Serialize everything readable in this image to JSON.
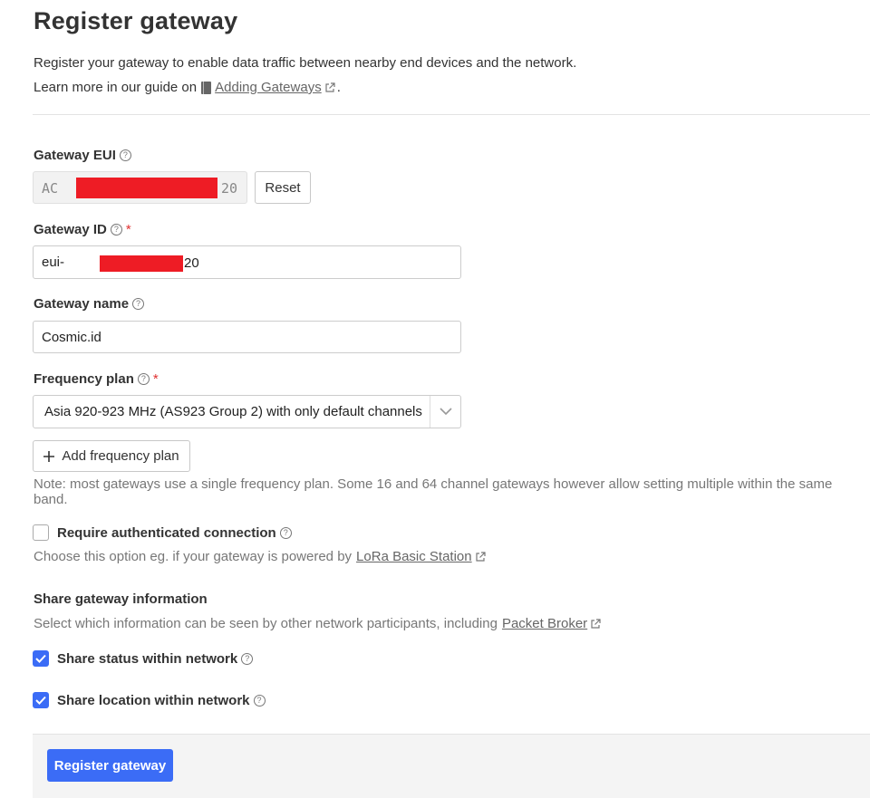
{
  "header": {
    "title": "Register gateway",
    "description": "Register your gateway to enable data traffic between nearby end devices and the network.",
    "guide_prefix": "Learn more in our guide on",
    "guide_link": "Adding Gateways",
    "guide_suffix": "."
  },
  "eui": {
    "label": "Gateway EUI",
    "prefix": "AC",
    "suffix": "20",
    "reset_label": "Reset"
  },
  "gateway_id": {
    "label": "Gateway ID",
    "required_mark": "*",
    "prefix": "eui-",
    "suffix": "20"
  },
  "gateway_name": {
    "label": "Gateway name",
    "value": "Cosmic.id"
  },
  "frequency": {
    "label": "Frequency plan",
    "required_mark": "*",
    "selected": "Asia 920-923 MHz (AS923 Group 2) with only default channels",
    "add_label": "Add frequency plan",
    "note": "Note: most gateways use a single frequency plan. Some 16 and 64 channel gateways however allow setting multiple within the same band."
  },
  "auth": {
    "label": "Require authenticated connection",
    "checked": false,
    "hint_prefix": "Choose this option eg. if your gateway is powered by",
    "hint_link": "LoRa Basic Station"
  },
  "share": {
    "heading": "Share gateway information",
    "hint_prefix": "Select which information can be seen by other network participants, including",
    "hint_link": "Packet Broker",
    "status_label": "Share status within network",
    "status_checked": true,
    "location_label": "Share location within network",
    "location_checked": true
  },
  "footer": {
    "submit_label": "Register gateway"
  },
  "colors": {
    "accent": "#3b6cf6",
    "required": "#e03131",
    "redaction": "#ee1c25"
  },
  "icons": [
    "help-icon",
    "book-icon",
    "external-link-icon",
    "chevron-down-icon",
    "plus-icon",
    "checkmark-icon"
  ]
}
